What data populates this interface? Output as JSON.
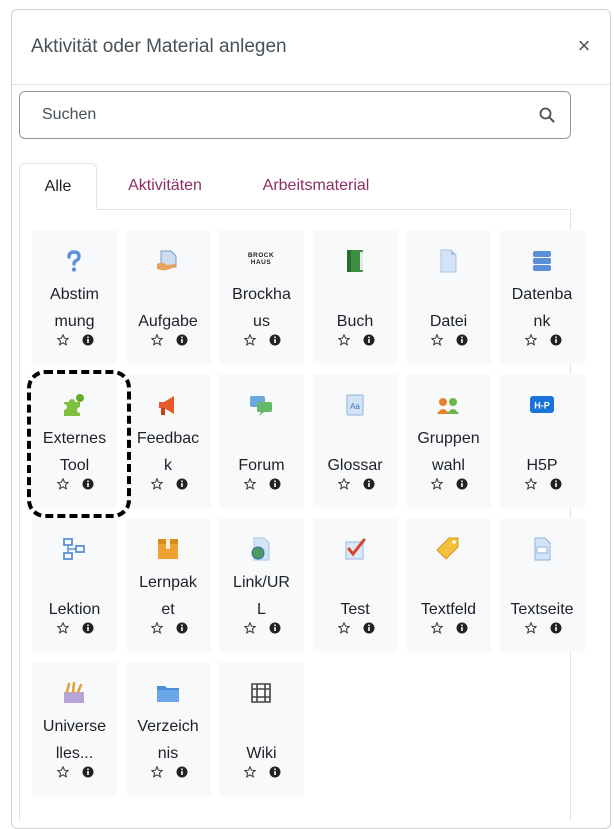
{
  "dialog": {
    "title": "Aktivität oder Material anlegen",
    "close_label": "×"
  },
  "search": {
    "placeholder": "Suchen"
  },
  "tabs": [
    {
      "label": "Alle",
      "active": true
    },
    {
      "label": "Aktivitäten",
      "active": false
    },
    {
      "label": "Arbeitsmaterial",
      "active": false
    }
  ],
  "brockhaus_logo": "BROCK HAUS",
  "modules": [
    {
      "line1": "Abstim",
      "line2": "mung",
      "icon": "question-icon"
    },
    {
      "line1": "",
      "line2": "Aufgabe",
      "icon": "assignment-icon"
    },
    {
      "line1": "Brockha",
      "line2": "us",
      "icon": "brockhaus-logo-icon"
    },
    {
      "line1": "",
      "line2": "Buch",
      "icon": "book-icon"
    },
    {
      "line1": "",
      "line2": "Datei",
      "icon": "file-icon"
    },
    {
      "line1": "Datenba",
      "line2": "nk",
      "icon": "database-icon"
    },
    {
      "line1": "Externes",
      "line2": "Tool",
      "icon": "puzzle-icon"
    },
    {
      "line1": "Feedbac",
      "line2": "k",
      "icon": "megaphone-icon"
    },
    {
      "line1": "",
      "line2": "Forum",
      "icon": "forum-icon"
    },
    {
      "line1": "",
      "line2": "Glossar",
      "icon": "glossary-icon"
    },
    {
      "line1": "Gruppen",
      "line2": "wahl",
      "icon": "group-choice-icon"
    },
    {
      "line1": "",
      "line2": "H5P",
      "icon": "h5p-icon"
    },
    {
      "line1": "",
      "line2": "Lektion",
      "icon": "lesson-icon"
    },
    {
      "line1": "Lernpak",
      "line2": "et",
      "icon": "package-icon"
    },
    {
      "line1": "Link/UR",
      "line2": "L",
      "icon": "url-icon"
    },
    {
      "line1": "",
      "line2": "Test",
      "icon": "quiz-icon"
    },
    {
      "line1": "",
      "line2": "Textfeld",
      "icon": "label-tag-icon"
    },
    {
      "line1": "",
      "line2": "Textseite",
      "icon": "page-icon"
    },
    {
      "line1": "Universe",
      "line2": "lles...",
      "icon": "universal-icon"
    },
    {
      "line1": "Verzeich",
      "line2": "nis",
      "icon": "folder-icon"
    },
    {
      "line1": "",
      "line2": "Wiki",
      "icon": "wiki-icon"
    }
  ],
  "colors": {
    "accent_link": "#8e2f60",
    "tile_bg": "#f8f9fa",
    "highlight_border": "#000000"
  }
}
